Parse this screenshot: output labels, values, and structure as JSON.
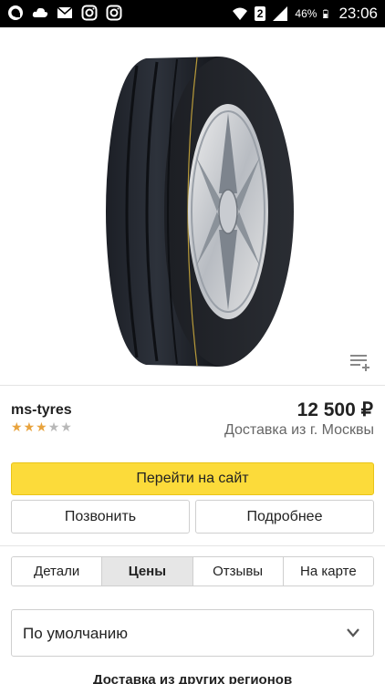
{
  "status_bar": {
    "time": "23:06",
    "battery_percent": "46%",
    "sim_slot": "2",
    "left_icons": [
      "notification-app-icon",
      "cloud-icon",
      "mail-icon",
      "instagram-icon",
      "instagram-icon"
    ],
    "right_icons": [
      "wifi-icon",
      "signal-icon",
      "battery-icon"
    ]
  },
  "product": {
    "image_icon": "tire-product-image",
    "add_to_list_icon": "add-to-list-icon"
  },
  "offer": {
    "shop_name": "ms-tyres",
    "rating": 3,
    "rating_max": 5,
    "price": "12 500 ₽",
    "delivery": "Доставка из г. Москвы"
  },
  "actions": {
    "go_to_site": "Перейти на сайт",
    "call": "Позвонить",
    "more": "Подробнее"
  },
  "tabs": [
    {
      "label": "Детали",
      "active": false
    },
    {
      "label": "Цены",
      "active": true
    },
    {
      "label": "Отзывы",
      "active": false
    },
    {
      "label": "На карте",
      "active": false
    }
  ],
  "sort": {
    "selected": "По умолчанию"
  },
  "section_heading": "Доставка из других регионов",
  "colors": {
    "accent_button": "#fcdb3a",
    "star_on": "#e8a33d",
    "star_off": "#b8b8b8"
  }
}
